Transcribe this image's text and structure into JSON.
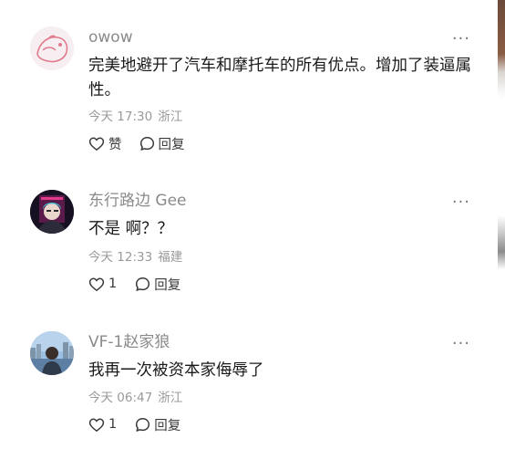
{
  "comments": [
    {
      "username": "owow",
      "text": "完美地避开了汽车和摩托车的所有优点。增加了装逼属性。",
      "time": "今天 17:30",
      "location": "浙江",
      "like_label": "赞",
      "reply_label": "回复",
      "more_label": "···"
    },
    {
      "username": "东行路边 Gee",
      "text": "不是 啊？？",
      "time": "今天 12:33",
      "location": "福建",
      "like_count": "1",
      "reply_label": "回复",
      "more_label": "···"
    },
    {
      "username": "VF-1赵家狼",
      "text": "我再一次被资本家侮辱了",
      "time": "今天 06:47",
      "location": "浙江",
      "like_count": "1",
      "reply_label": "回复",
      "more_label": "···"
    }
  ]
}
